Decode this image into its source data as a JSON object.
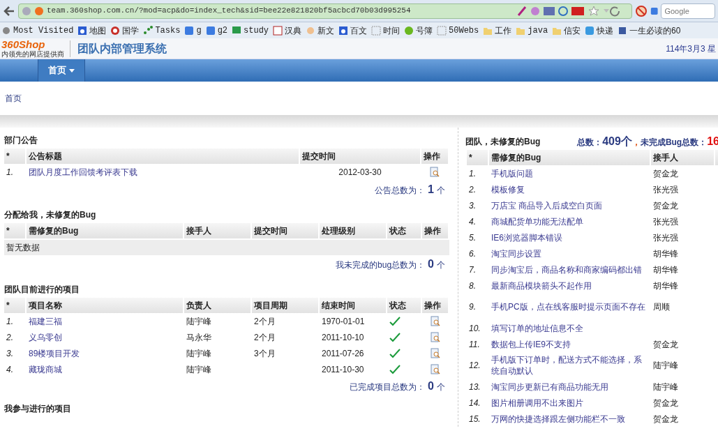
{
  "browser": {
    "url": "team.360shop.com.cn/?mod=acp&do=index_tech&sid=bee22e821820bf5acbcd70b03d995254",
    "search_placeholder": "Google",
    "bookmarks": [
      {
        "label": "Most Visited",
        "kind": "gear"
      },
      {
        "label": "地图",
        "kind": "paw"
      },
      {
        "label": "国学",
        "kind": "circle"
      },
      {
        "label": "Tasks",
        "kind": "dots"
      },
      {
        "label": "g",
        "kind": "g"
      },
      {
        "label": "g2",
        "kind": "g"
      },
      {
        "label": "study",
        "kind": "chat"
      },
      {
        "label": "汉典",
        "kind": "book"
      },
      {
        "label": "新文",
        "kind": "person"
      },
      {
        "label": "百文",
        "kind": "paw"
      },
      {
        "label": "时间",
        "kind": "blank"
      },
      {
        "label": "号簿",
        "kind": "phone"
      },
      {
        "label": "50Webs",
        "kind": "blank"
      },
      {
        "label": "工作",
        "kind": "folder"
      },
      {
        "label": "java",
        "kind": "folder"
      },
      {
        "label": "信安",
        "kind": "folder"
      },
      {
        "label": "快递",
        "kind": "face"
      },
      {
        "label": "一生必读的60",
        "kind": "e"
      }
    ]
  },
  "header": {
    "logo": "360Shop",
    "logo_tagline": "内领先的网店提供商",
    "title": "团队内部管理系统",
    "date": "114年3月3 星"
  },
  "nav": [
    {
      "label": "首页",
      "selected": true
    }
  ],
  "breadcrumb": "首页",
  "announcements": {
    "title": "部门公告",
    "columns": [
      "*",
      "公告标题",
      "提交时间",
      "操作"
    ],
    "rows": [
      {
        "index": "1.",
        "title": "团队月度工作回馈考评表下载",
        "date": "2012-03-30"
      }
    ],
    "total_label": "公告总数为：",
    "total": "1",
    "unit": "个"
  },
  "my_bugs": {
    "title": "分配给我，未修复的Bug",
    "columns": [
      "*",
      "需修复的Bug",
      "接手人",
      "提交时间",
      "处理级别",
      "状态",
      "操作"
    ],
    "empty": "暂无数据",
    "total_label": "我未完成的bug总数为：",
    "total": "0",
    "unit": "个"
  },
  "team_projects": {
    "title": "团队目前进行的项目",
    "columns": [
      "*",
      "项目名称",
      "负责人",
      "项目周期",
      "结束时间",
      "状态",
      "操作"
    ],
    "rows": [
      {
        "index": "1.",
        "name": "福建三福",
        "owner": "陆宇峰",
        "period": "2个月",
        "end": "1970-01-01",
        "done": true
      },
      {
        "index": "2.",
        "name": "义乌零创",
        "owner": "马永华",
        "period": "2个月",
        "end": "2011-10-10",
        "done": true
      },
      {
        "index": "3.",
        "name": "89楼项目开发",
        "owner": "陆宇峰",
        "period": "3个月",
        "end": "2011-07-26",
        "done": true
      },
      {
        "index": "4.",
        "name": "藏珑商城",
        "owner": "陆宇峰",
        "end": "2011-10-30",
        "done": true
      }
    ],
    "total_label": "已完成项目总数为：",
    "total": "0",
    "unit": "个"
  },
  "my_projects": {
    "title": "我参与进行的项目"
  },
  "team_bugs": {
    "title": "团队，未修复的Bug",
    "total_label": "总数：",
    "total": "409个",
    "separator": "，",
    "open_label": "未完成Bug总数：",
    "open": "16",
    "columns": [
      "*",
      "需修复的Bug",
      "接手人"
    ],
    "rows": [
      {
        "index": "1.",
        "bug": "手机版问题",
        "owner": "贺金龙"
      },
      {
        "index": "2.",
        "bug": "模板修复",
        "owner": "张光强"
      },
      {
        "index": "3.",
        "bug": "万店宝 商品导入后成空白页面",
        "owner": "贺金龙"
      },
      {
        "index": "4.",
        "bug": "商城配货单功能无法配单",
        "owner": "张光强"
      },
      {
        "index": "5.",
        "bug": "IE6浏览器脚本错误",
        "owner": "张光强"
      },
      {
        "index": "6.",
        "bug": "淘宝同步设置",
        "owner": "胡华锋"
      },
      {
        "index": "7.",
        "bug": "同步淘宝后，商品名称和商家编码都出错",
        "owner": "胡华锋"
      },
      {
        "index": "8.",
        "bug": "最新商品模块箭头不起作用",
        "owner": "胡华锋"
      },
      {
        "index": "9.",
        "bug": "手机PC版，点在线客服时提示页面不存在",
        "owner": "周顺"
      },
      {
        "index": "10.",
        "bug": "填写订单的地址信息不全"
      },
      {
        "index": "11.",
        "bug": "数据包上传IE9不支持",
        "owner": "贺金龙"
      },
      {
        "index": "12.",
        "bug": "手机版下订单时，配送方式不能选择，系统自动默认",
        "owner": "陆宇峰"
      },
      {
        "index": "13.",
        "bug": "淘宝同步更新已有商品功能无用",
        "owner": "陆宇峰"
      },
      {
        "index": "14.",
        "bug": "图片相册调用不出来图片",
        "owner": "贺金龙"
      },
      {
        "index": "15.",
        "bug": "万网的快捷选择跟左侧功能栏不一致",
        "owner": "贺金龙"
      }
    ]
  }
}
